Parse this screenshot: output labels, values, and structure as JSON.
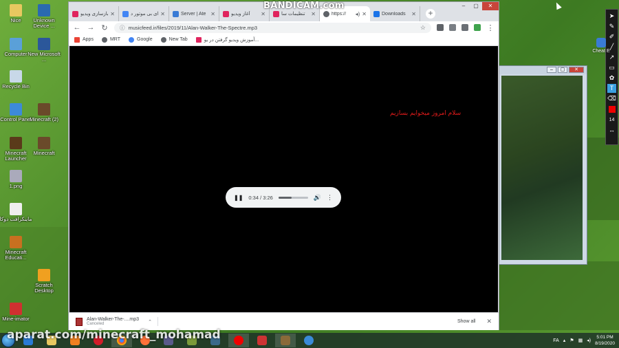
{
  "watermark": "BANDICAM.com",
  "aparat_watermark": "aparat.com/minecraft_mohamad",
  "desktop_icons": [
    {
      "label": "Nice",
      "color": "#e8c860"
    },
    {
      "label": "Unknown Device ...",
      "color": "#2a6ab0"
    },
    {
      "label": "Computer",
      "color": "#5aa0d8"
    },
    {
      "label": "New Microsoft ...",
      "color": "#2b579a"
    },
    {
      "label": "Recycle Bin",
      "color": "#c8d8e8"
    },
    {
      "label": "Control Panel",
      "color": "#3d8ad8"
    },
    {
      "label": "Minecraft (2)",
      "color": "#6a4a2a"
    },
    {
      "label": "Minecraft Launcher",
      "color": "#5a3a1a"
    },
    {
      "label": "Minecraft",
      "color": "#6a4a2a"
    },
    {
      "label": "1.png",
      "color": "#aab"
    },
    {
      "label": "ماینکرافت دوکا",
      "color": "#eee"
    },
    {
      "label": "Minecraft Educati...",
      "color": "#c87020"
    },
    {
      "label": "Scratch Desktop",
      "color": "#f0a020"
    },
    {
      "label": "Mine-imator",
      "color": "#d03030"
    }
  ],
  "browser": {
    "tabs": [
      {
        "title": "بازسازی ویدیو",
        "fav_color": "#e0245e"
      },
      {
        "title": "ای بی موتور د",
        "fav_color": "#4285f4"
      },
      {
        "title": "Server | Ate",
        "fav_color": "#3a7bd5"
      },
      {
        "title": "آغاز ویدیو",
        "fav_color": "#e0245e"
      },
      {
        "title": "تنظیمات سا",
        "fav_color": "#e0245e"
      },
      {
        "title": "https://",
        "fav_color": "#5f6368",
        "active": true
      },
      {
        "title": "Downloads",
        "fav_color": "#1a73e8"
      }
    ],
    "new_tab_symbol": "+",
    "window_controls": [
      "–",
      "▢",
      "✕"
    ],
    "url": "musicfeed.ir/files/2019/11/Alan-Walker-The-Spectre.mp3",
    "bookmarks": [
      {
        "label": "Apps",
        "color": "#ea4335"
      },
      {
        "label": "MRT",
        "color": "#5f6368"
      },
      {
        "label": "Google",
        "color": "#4285f4"
      },
      {
        "label": "New Tab",
        "color": "#5f6368"
      },
      {
        "label": "آموزش ویدیو گرفتن در یو...",
        "color": "#e0245e"
      }
    ],
    "overlay_text": "سلام امروز میخوایم بسازیم",
    "player": {
      "time": "0:34 / 3:26",
      "progress": 0.45
    },
    "download": {
      "filename": "Alan-Walker-The-....mp3",
      "status": "Canceled",
      "show_all": "Show all"
    }
  },
  "palette": {
    "size_value": "14",
    "text_tool": "T"
  },
  "cheat_label": "Cheat E",
  "tray": {
    "lang": "FA",
    "time": "5:01 PM",
    "date": "8/19/2020"
  }
}
